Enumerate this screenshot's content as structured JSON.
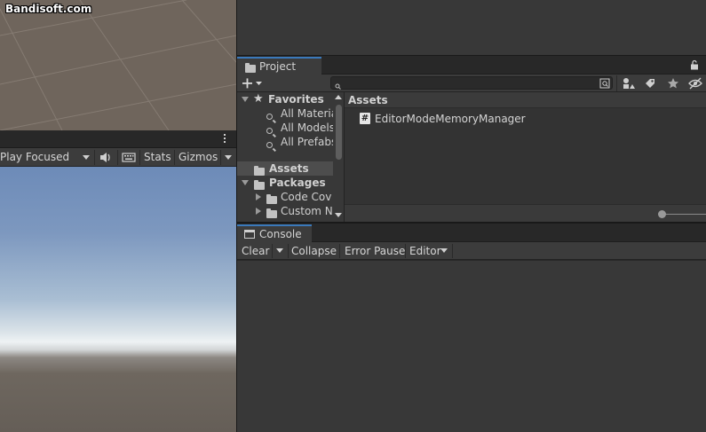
{
  "watermark": "Bandisoft.com",
  "game_toolbar": {
    "play_mode": "Play Focused",
    "stats": "Stats",
    "gizmos": "Gizmos",
    "mute_icon": "speaker-icon",
    "keyboard_icon": "keyboard-icon",
    "more_icon": "kebab-menu-icon"
  },
  "project": {
    "tab_label": "Project",
    "search": {
      "value": "",
      "placeholder": ""
    },
    "favorites": {
      "label": "Favorites",
      "items": [
        "All Materia",
        "All Models",
        "All Prefabs"
      ]
    },
    "assets_label": "Assets",
    "packages": {
      "label": "Packages",
      "items": [
        "Code Cov",
        "Custom NU"
      ]
    },
    "breadcrumb": "Assets",
    "files": [
      {
        "name": "EditorModeMemoryManager",
        "icon": "csharp-script-icon"
      }
    ]
  },
  "console": {
    "tab_label": "Console",
    "toolbar": {
      "clear": "Clear",
      "collapse": "Collapse",
      "error_pause": "Error Pause",
      "editor": "Editor"
    }
  },
  "colors": {
    "accent": "#3a79bb",
    "panel": "#383838",
    "toolbar": "#3c3c3c"
  }
}
